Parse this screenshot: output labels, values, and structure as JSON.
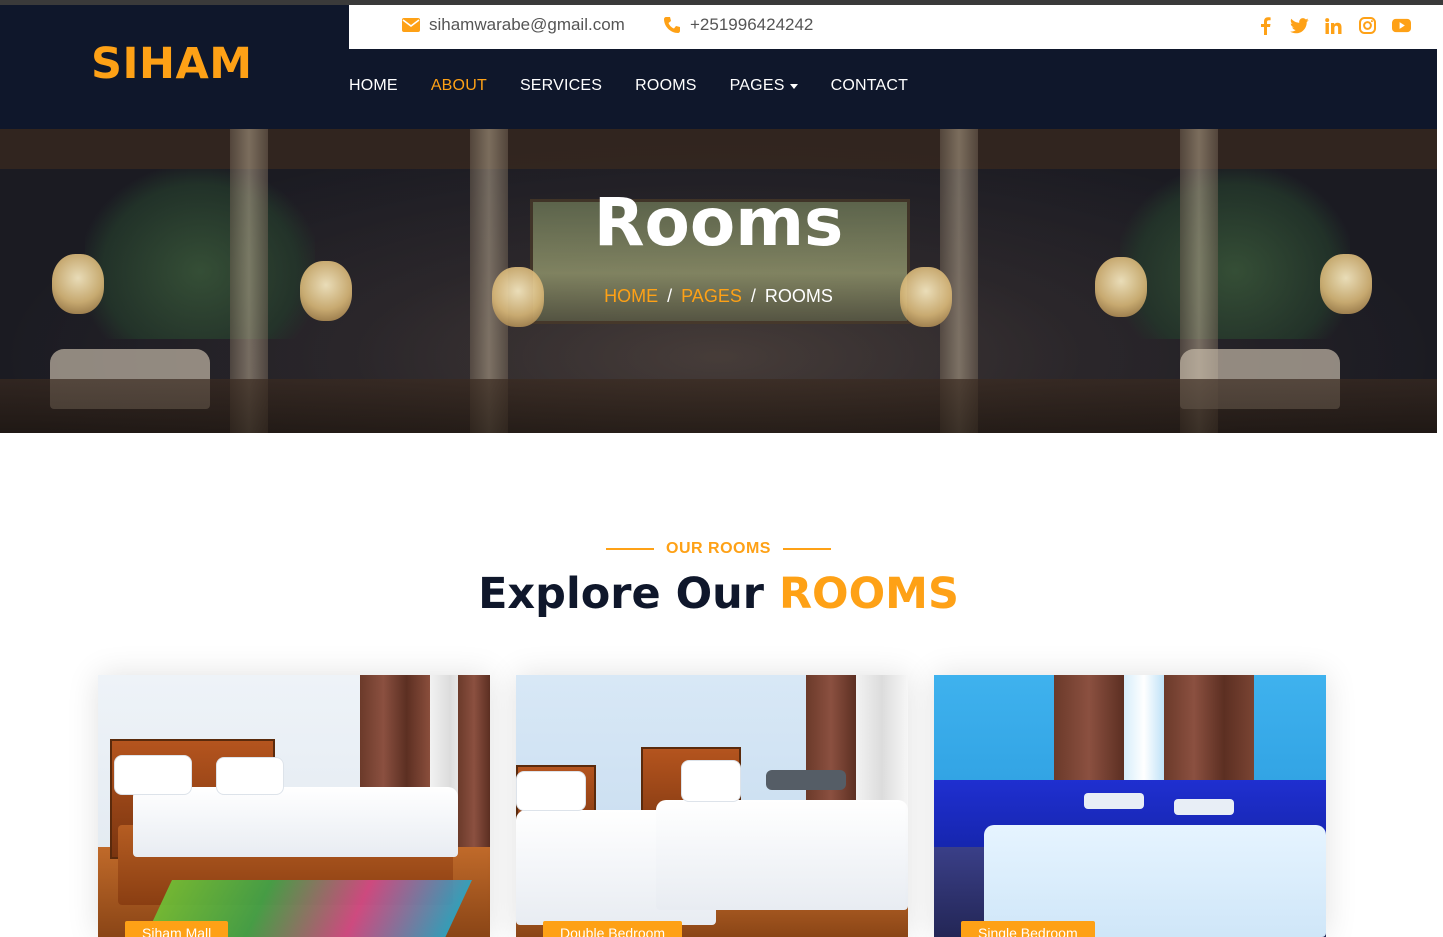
{
  "brand": {
    "logo": "SIHAM",
    "accent": "#fea116",
    "dark": "#0f172b"
  },
  "topbar": {
    "email": "sihamwarabe@gmail.com",
    "phone": "+251996424242",
    "social_icons": [
      "facebook-icon",
      "twitter-icon",
      "linkedin-icon",
      "instagram-icon",
      "youtube-icon"
    ]
  },
  "nav": {
    "items": [
      {
        "label": "HOME"
      },
      {
        "label": "ABOUT",
        "active": true
      },
      {
        "label": "SERVICES"
      },
      {
        "label": "ROOMS"
      },
      {
        "label": "PAGES",
        "dropdown": true
      },
      {
        "label": "CONTACT"
      }
    ]
  },
  "hero": {
    "title": "Rooms",
    "breadcrumb": [
      {
        "label": "HOME"
      },
      {
        "label": "PAGES"
      },
      {
        "label": "ROOMS"
      }
    ]
  },
  "section": {
    "subtitle": "OUR ROOMS",
    "title_plain": "Explore Our",
    "title_highlight": "ROOMS"
  },
  "rooms": [
    {
      "label": "Siham Mall"
    },
    {
      "label": "Double Bedroom"
    },
    {
      "label": "Single Bedroom"
    }
  ]
}
